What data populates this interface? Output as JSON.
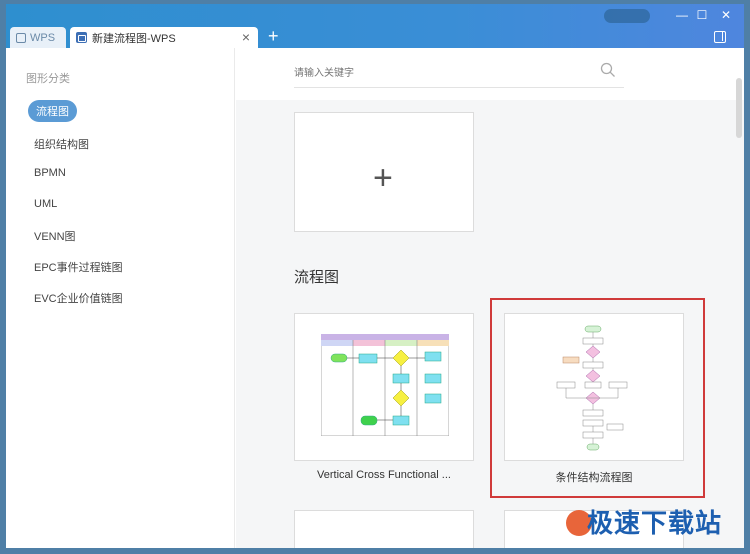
{
  "titlebar": {
    "app_tab": "WPS",
    "doc_tab": "新建流程图-WPS",
    "close_symbol": "×",
    "new_tab_symbol": "+",
    "minimize": "—",
    "maximize": "☐",
    "close": "✕"
  },
  "sidebar": {
    "title": "图形分类",
    "items": [
      {
        "label": "流程图",
        "active": true
      },
      {
        "label": "组织结构图"
      },
      {
        "label": "BPMN"
      },
      {
        "label": "UML"
      },
      {
        "label": "VENN图"
      },
      {
        "label": "EPC事件过程链图"
      },
      {
        "label": "EVC企业价值链图"
      }
    ]
  },
  "main": {
    "search_placeholder": "请输入关键字",
    "new_card_symbol": "+",
    "section_title": "流程图",
    "templates": [
      {
        "label": "Vertical Cross Functional ..."
      },
      {
        "label": "条件结构流程图",
        "highlighted": true
      }
    ]
  },
  "watermark": "极速下载站",
  "colors": {
    "titlebar": "#3a8ed6",
    "active_item": "#5b9bd5",
    "highlight": "#d03a3a"
  }
}
